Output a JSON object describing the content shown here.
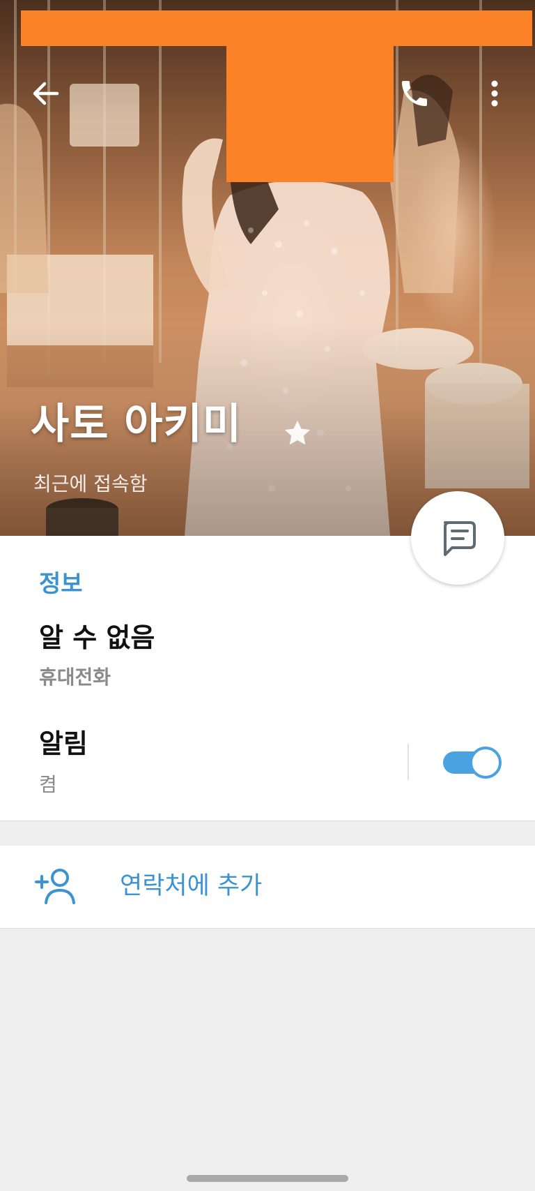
{
  "header": {
    "profile_name": "사토 아키미",
    "status": "최근에 접속함",
    "photo_description_icon": "profile-photo",
    "back_icon": "arrow-left-icon",
    "call_icon": "phone-icon",
    "more_icon": "more-vertical-icon",
    "favorite_icon": "star-icon",
    "redaction_color": "#fb8226"
  },
  "info": {
    "section_title": "정보",
    "phone_value": "알 수 없음",
    "phone_label": "휴대전화",
    "notifications_title": "알림",
    "notifications_state": "켬",
    "notifications_enabled": true
  },
  "actions": {
    "message_icon": "message-icon",
    "add_contact_label": "연락처에 추가",
    "add_contact_icon": "add-user-icon"
  },
  "theme": {
    "accent": "#3b93d2",
    "toggle": "#4aa3df",
    "background": "#efefef"
  }
}
